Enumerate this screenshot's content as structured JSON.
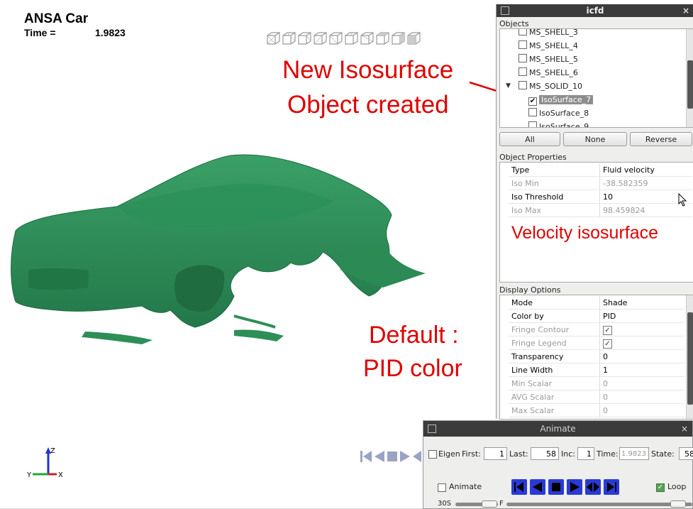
{
  "viewport": {
    "title": "ANSA Car",
    "time_label": "Time =",
    "time_value": "1.9823",
    "axes": {
      "z": "Z",
      "y": "Y",
      "x": "X"
    }
  },
  "annotations": {
    "iso_line1": "New Isosurface",
    "iso_line2": "Object created",
    "velocity": "Velocity isosurface",
    "default_line1": "Default :",
    "default_line2": "PID color",
    "color": "#e00000"
  },
  "icfd": {
    "title": "icfd",
    "objects_label": "Objects",
    "objects": [
      {
        "label": "MS_SHELL_3",
        "checked": false
      },
      {
        "label": "MS_SHELL_4",
        "checked": false
      },
      {
        "label": "MS_SHELL_5",
        "checked": false
      },
      {
        "label": "MS_SHELL_6",
        "checked": false
      },
      {
        "label": "MS_SOLID_10",
        "checked": false,
        "expanded": true
      },
      {
        "label": "IsoSurface_7",
        "checked": true,
        "selected": true
      },
      {
        "label": "IsoSurface_8",
        "checked": false
      },
      {
        "label": "IsoSurface_9",
        "checked": false
      }
    ],
    "buttons": {
      "all": "All",
      "none": "None",
      "reverse": "Reverse"
    },
    "props_label": "Object Properties",
    "properties": [
      {
        "key": "Type",
        "value": "Fluid velocity",
        "dim": false
      },
      {
        "key": "Iso Min",
        "value": "-38.582359",
        "dim": true
      },
      {
        "key": "Iso Threshold",
        "value": "10",
        "dim": false
      },
      {
        "key": "Iso Max",
        "value": "98.459824",
        "dim": true
      }
    ],
    "display_label": "Display Options",
    "display": [
      {
        "key": "Mode",
        "value": "Shade",
        "dim": false
      },
      {
        "key": "Color by",
        "value": "PID",
        "dim": false
      },
      {
        "key": "Fringe Contour",
        "value": "✓",
        "dim": true,
        "check": true
      },
      {
        "key": "Fringe Legend",
        "value": "✓",
        "dim": true,
        "check": true
      },
      {
        "key": "Transparency",
        "value": "0",
        "dim": false
      },
      {
        "key": "Line Width",
        "value": "1",
        "dim": false
      },
      {
        "key": "Min Scalar",
        "value": "0",
        "dim": true
      },
      {
        "key": "AVG Scalar",
        "value": "0",
        "dim": true
      },
      {
        "key": "Max Scalar",
        "value": "0",
        "dim": true
      }
    ]
  },
  "animate": {
    "title": "Animate",
    "eigen_label": "Eigen",
    "first_label": "First:",
    "first_value": "1",
    "last_label": "Last:",
    "last_value": "58",
    "inc_label": "Inc:",
    "inc_value": "1",
    "time_label": "Time:",
    "time_value": "1.9823",
    "state_label": "State:",
    "state_value": "58",
    "animate_label": "Animate",
    "loop_label": "Loop",
    "loop_checked": true,
    "speed_label": "30S",
    "frame_label": "F"
  },
  "colors": {
    "car_green": "#2e8b57",
    "player_blue": "#2a3ad6"
  }
}
